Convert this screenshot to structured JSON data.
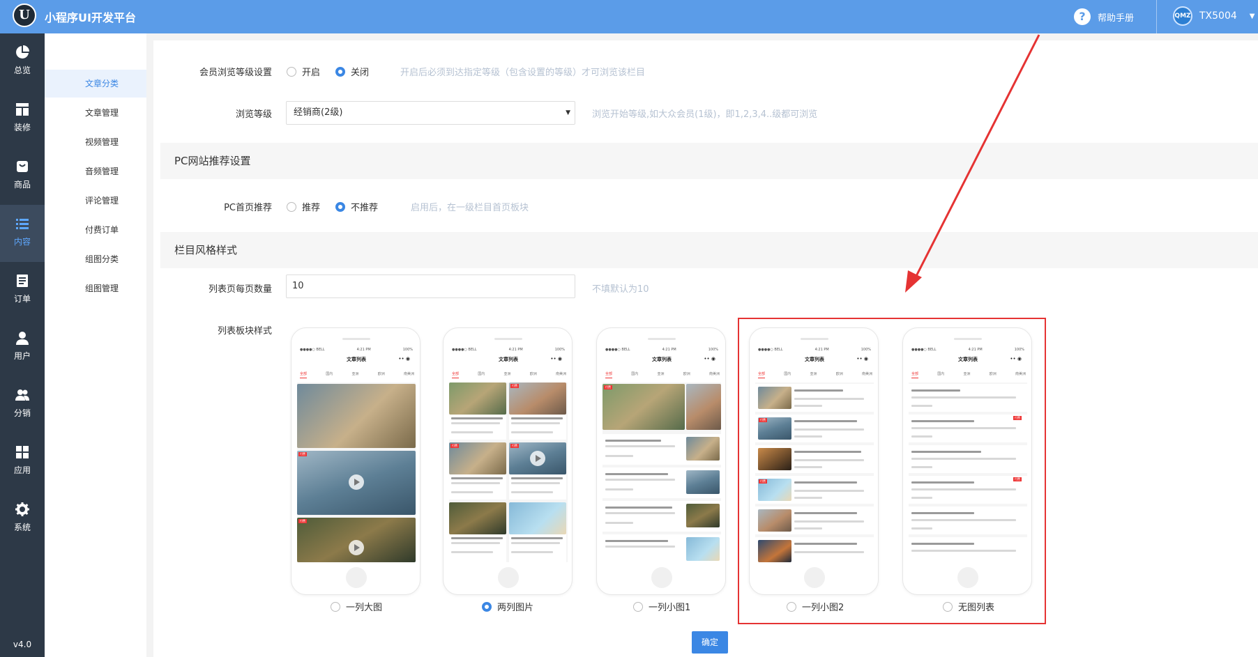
{
  "app": {
    "logo_letter": "U",
    "title": "小程序UI开发平台"
  },
  "header": {
    "help_label": "帮助手册",
    "username": "TX5004",
    "avatar_text": "QMZ"
  },
  "leftnav": {
    "items": [
      {
        "label": "总览",
        "icon": "pie-chart-icon"
      },
      {
        "label": "装修",
        "icon": "layout-icon"
      },
      {
        "label": "商品",
        "icon": "shopping-bag-icon"
      },
      {
        "label": "内容",
        "icon": "list-icon"
      },
      {
        "label": "订单",
        "icon": "document-icon"
      },
      {
        "label": "用户",
        "icon": "user-icon"
      },
      {
        "label": "分销",
        "icon": "users-icon"
      },
      {
        "label": "应用",
        "icon": "grid-icon"
      },
      {
        "label": "系统",
        "icon": "gear-icon"
      }
    ],
    "active_index": 3,
    "version": "v4.0"
  },
  "subnav": {
    "items": [
      "文章分类",
      "文章管理",
      "视频管理",
      "音频管理",
      "评论管理",
      "付费订单",
      "组图分类",
      "组图管理"
    ],
    "active_index": 0
  },
  "form": {
    "member_level": {
      "label": "会员浏览等级设置",
      "options": [
        "开启",
        "关闭"
      ],
      "selected": "关闭",
      "hint": "开启后必须到达指定等级（包含设置的等级）才可浏览该栏目"
    },
    "browse_level": {
      "label": "浏览等级",
      "value": "经销商(2级)",
      "hint": "浏览开始等级,如大众会员(1级)，即1,2,3,4..级都可浏览"
    },
    "pc_section": {
      "title": "PC网站推荐设置"
    },
    "pc_home": {
      "label": "PC首页推荐",
      "options": [
        "推荐",
        "不推荐"
      ],
      "selected": "不推荐",
      "hint": "启用后，在一级栏目首页板块"
    },
    "style_section": {
      "title": "栏目风格样式"
    },
    "page_size": {
      "label": "列表页每页数量",
      "value": "10",
      "hint": "不填默认为10"
    },
    "list_style": {
      "label": "列表板块样式",
      "options": [
        "一列大图",
        "两列图片",
        "一列小图1",
        "一列小图2",
        "无图列表"
      ],
      "selected": "两列图片"
    },
    "submit_label": "确定"
  },
  "phone": {
    "status_left": "●●●●○ BELL",
    "status_time": "4:21 PM",
    "status_right": "100%",
    "title": "文章列表",
    "tabs": [
      "全部",
      "国内",
      "亚洲",
      "欧洲",
      "南美洲"
    ]
  },
  "colors": {
    "primary": "#3b87e4",
    "header": "#5b9ce8",
    "sidebar": "#2d3947",
    "highlight": "#e53333"
  }
}
